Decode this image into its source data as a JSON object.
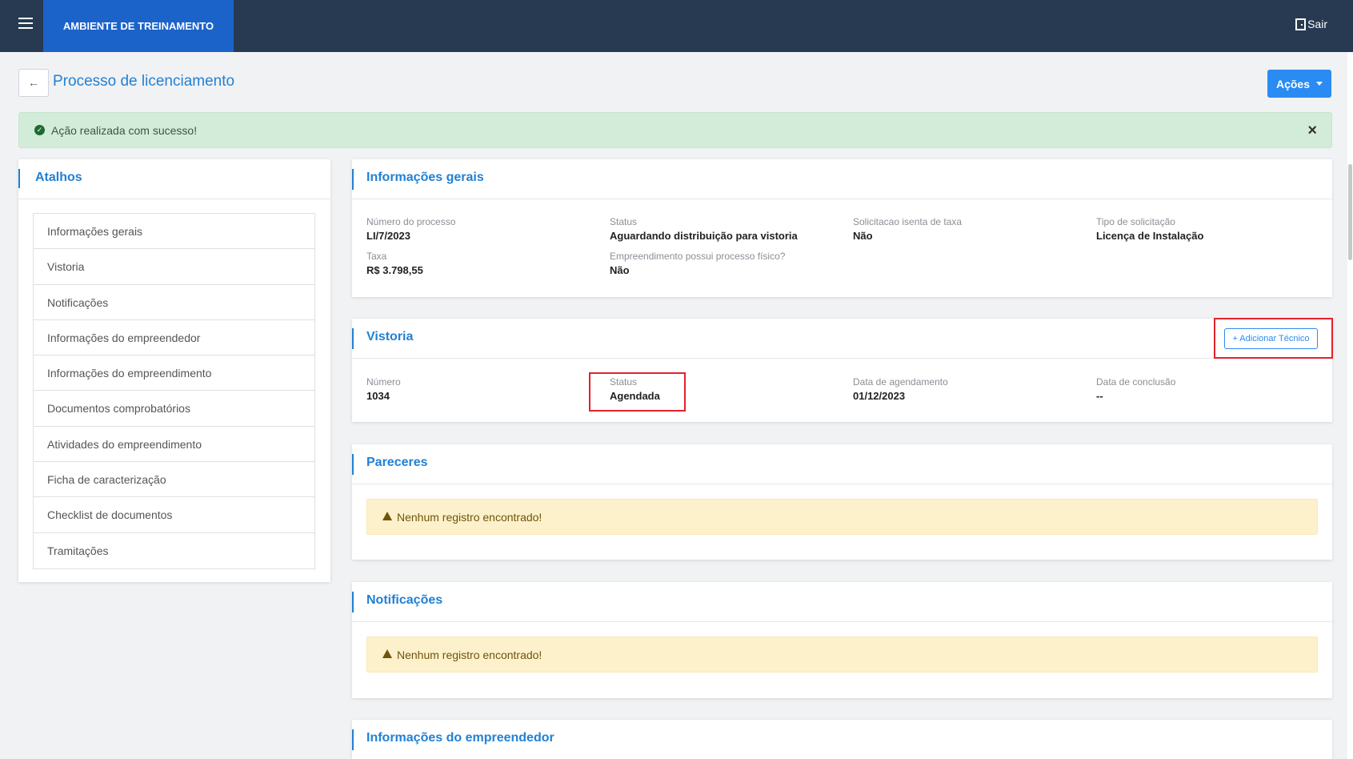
{
  "header": {
    "environment_label": "AMBIENTE DE TREINAMENTO",
    "logout_label": "Sair"
  },
  "page": {
    "title": "Processo de licenciamento",
    "back_icon": "arrow-left-icon",
    "actions_label": "Ações"
  },
  "alert": {
    "message": "Ação realizada com sucesso!",
    "close_symbol": "×"
  },
  "sidebar": {
    "title": "Atalhos",
    "items": [
      {
        "label": "Informações gerais"
      },
      {
        "label": "Vistoria"
      },
      {
        "label": "Notificações"
      },
      {
        "label": "Informações do empreendedor"
      },
      {
        "label": "Informações do empreendimento"
      },
      {
        "label": "Documentos comprobatórios"
      },
      {
        "label": "Atividades do empreendimento"
      },
      {
        "label": "Ficha de caracterização"
      },
      {
        "label": "Checklist de documentos"
      },
      {
        "label": "Tramitações"
      }
    ]
  },
  "general": {
    "title": "Informações gerais",
    "fields": [
      {
        "label": "Número do processo",
        "value": "LI/7/2023"
      },
      {
        "label": "Status",
        "value": "Aguardando distribuição para vistoria"
      },
      {
        "label": "Solicitacao isenta de taxa",
        "value": "Não"
      },
      {
        "label": "Tipo de solicitação",
        "value": "Licença de Instalação"
      },
      {
        "label": "Taxa",
        "value": "R$ 3.798,55"
      },
      {
        "label": "Empreendimento possui processo físico?",
        "value": "Não"
      }
    ]
  },
  "inspection": {
    "title": "Vistoria",
    "add_tech_label": "+ Adicionar Técnico",
    "fields": [
      {
        "label": "Número",
        "value": "1034"
      },
      {
        "label": "Status",
        "value": "Agendada"
      },
      {
        "label": "Data de agendamento",
        "value": "01/12/2023"
      },
      {
        "label": "Data de conclusão",
        "value": "--"
      }
    ]
  },
  "opinions": {
    "title": "Pareceres",
    "empty_message": "Nenhum registro encontrado!"
  },
  "notifications": {
    "title": "Notificações",
    "empty_message": "Nenhum registro encontrado!"
  },
  "entrepreneur": {
    "title": "Informações do empreendedor"
  },
  "colors": {
    "topbar": "#273a52",
    "env_badge": "#1c63c9",
    "accent": "#2181d4",
    "primary_button": "#2a8bf2",
    "success_bg": "#d3ecd9",
    "warning_bg": "#fdf1cc",
    "highlight_red": "#e3212c"
  }
}
